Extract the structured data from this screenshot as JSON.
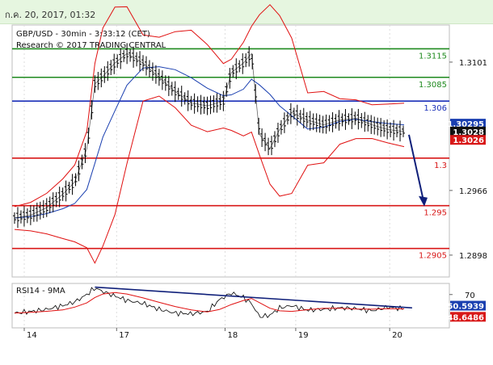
{
  "header": {
    "timestamp": "ก.ค. 20, 2017, 01:32"
  },
  "chart_data": {
    "type": "candlestick",
    "title": "GBP/USD - 30min - 3:33:12 (CET)",
    "subtitle": "Research © 2017 TRADING CENTRAL",
    "colors": {
      "price": "#000000",
      "bollinger": "#e01010",
      "moving_average": "#1a3fb0",
      "green_levels": "#1f8a1f",
      "blue_level": "#1a2fb8",
      "red_levels": "#d81818",
      "forecast_arrow": "#10207a",
      "rsi_line": "#000000",
      "rsi_signal": "#e01010",
      "rsi_trendline": "#10207a"
    },
    "price_axis": {
      "ylim": [
        1.2875,
        1.314
      ],
      "tick_labels": [
        "1.3101",
        "1.2966",
        "1.2898"
      ],
      "tick_values": [
        1.3101,
        1.2966,
        1.2898
      ]
    },
    "x_axis": {
      "tick_labels": [
        "14",
        "17",
        "18",
        "19",
        "20"
      ]
    },
    "levels": [
      {
        "label": "1.3115",
        "value": 1.3115,
        "color": "green"
      },
      {
        "label": "1.3085",
        "value": 1.3085,
        "color": "green"
      },
      {
        "label": "1.306",
        "value": 1.306,
        "color": "blue"
      },
      {
        "label": "1.3",
        "value": 1.3,
        "color": "red"
      },
      {
        "label": "1.295",
        "value": 1.295,
        "color": "red"
      },
      {
        "label": "1.2905",
        "value": 1.2905,
        "color": "red"
      }
    ],
    "price_tags": [
      {
        "label": "1.30295",
        "value": 1.30295,
        "color": "blue"
      },
      {
        "label": "1.3028",
        "value": 1.3028,
        "color": "black"
      },
      {
        "label": "1.3026",
        "value": 1.3026,
        "color": "red"
      }
    ],
    "close_series": [
      {
        "day": "14",
        "t": 0,
        "close": 1.2937
      },
      {
        "day": "14",
        "t": 20,
        "close": 1.294
      },
      {
        "day": "14",
        "t": 40,
        "close": 1.2948
      },
      {
        "day": "14",
        "t": 60,
        "close": 1.2962
      },
      {
        "day": "14",
        "t": 75,
        "close": 1.2975
      },
      {
        "day": "14",
        "t": 90,
        "close": 1.301
      },
      {
        "day": "14",
        "t": 100,
        "close": 1.3078
      },
      {
        "day": "14",
        "t": 110,
        "close": 1.3086
      },
      {
        "day": "17",
        "t": 125,
        "close": 1.31
      },
      {
        "day": "17",
        "t": 140,
        "close": 1.311
      },
      {
        "day": "17",
        "t": 160,
        "close": 1.31
      },
      {
        "day": "17",
        "t": 180,
        "close": 1.3085
      },
      {
        "day": "17",
        "t": 200,
        "close": 1.307
      },
      {
        "day": "17",
        "t": 220,
        "close": 1.3058
      },
      {
        "day": "17",
        "t": 240,
        "close": 1.3055
      },
      {
        "day": "18",
        "t": 260,
        "close": 1.306
      },
      {
        "day": "18",
        "t": 270,
        "close": 1.309
      },
      {
        "day": "18",
        "t": 285,
        "close": 1.31
      },
      {
        "day": "18",
        "t": 295,
        "close": 1.311
      },
      {
        "day": "18",
        "t": 305,
        "close": 1.3025
      },
      {
        "day": "18",
        "t": 318,
        "close": 1.301
      },
      {
        "day": "18",
        "t": 330,
        "close": 1.303
      },
      {
        "day": "19",
        "t": 345,
        "close": 1.3048
      },
      {
        "day": "19",
        "t": 365,
        "close": 1.304
      },
      {
        "day": "19",
        "t": 385,
        "close": 1.3035
      },
      {
        "day": "19",
        "t": 405,
        "close": 1.304
      },
      {
        "day": "19",
        "t": 425,
        "close": 1.3042
      },
      {
        "day": "19",
        "t": 445,
        "close": 1.3035
      },
      {
        "day": "20",
        "t": 465,
        "close": 1.303
      },
      {
        "day": "20",
        "t": 485,
        "close": 1.3028
      }
    ],
    "forecast": {
      "target": 1.295
    },
    "rsi_panel": {
      "label": "RSI14 - 9MA",
      "ylim": [
        25,
        85
      ],
      "tick_labels": [
        "70"
      ],
      "tick_values": [
        70
      ],
      "value_tags": [
        {
          "label": "50.5939",
          "value": 50.5939,
          "color": "blue"
        },
        {
          "label": "48.6486",
          "value": 48.6486,
          "color": "red"
        }
      ],
      "rsi_series": [
        {
          "t": 0,
          "v": 45
        },
        {
          "t": 20,
          "v": 47
        },
        {
          "t": 40,
          "v": 50
        },
        {
          "t": 60,
          "v": 55
        },
        {
          "t": 75,
          "v": 60
        },
        {
          "t": 90,
          "v": 70
        },
        {
          "t": 100,
          "v": 79
        },
        {
          "t": 110,
          "v": 74
        },
        {
          "t": 125,
          "v": 68
        },
        {
          "t": 140,
          "v": 62
        },
        {
          "t": 160,
          "v": 58
        },
        {
          "t": 180,
          "v": 50
        },
        {
          "t": 200,
          "v": 45
        },
        {
          "t": 220,
          "v": 44
        },
        {
          "t": 240,
          "v": 47
        },
        {
          "t": 255,
          "v": 63
        },
        {
          "t": 270,
          "v": 72
        },
        {
          "t": 285,
          "v": 66
        },
        {
          "t": 295,
          "v": 58
        },
        {
          "t": 305,
          "v": 40
        },
        {
          "t": 318,
          "v": 42
        },
        {
          "t": 330,
          "v": 52
        },
        {
          "t": 345,
          "v": 55
        },
        {
          "t": 365,
          "v": 49
        },
        {
          "t": 385,
          "v": 50
        },
        {
          "t": 405,
          "v": 52
        },
        {
          "t": 425,
          "v": 51
        },
        {
          "t": 445,
          "v": 48
        },
        {
          "t": 465,
          "v": 53
        },
        {
          "t": 485,
          "v": 50.6
        }
      ]
    }
  }
}
